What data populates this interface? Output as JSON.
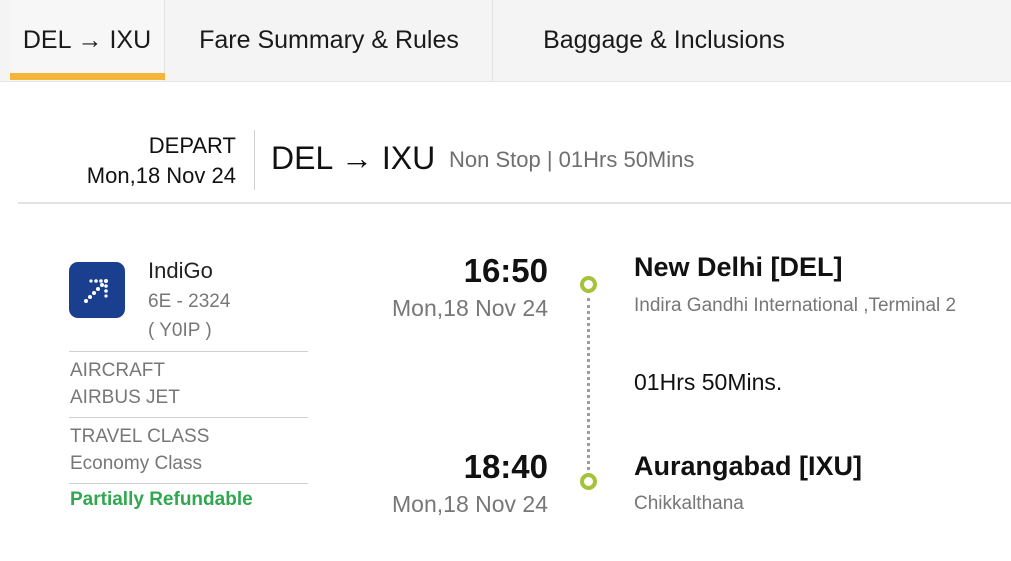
{
  "tabs": [
    {
      "label": "DEL → IXU",
      "active": true
    },
    {
      "label": "Fare Summary & Rules",
      "active": false
    },
    {
      "label": "Baggage & Inclusions",
      "active": false
    }
  ],
  "colors": {
    "active_tab_underline": "#f4b53a",
    "timeline_node": "#a4c23a",
    "refundable_text": "#2fa84f",
    "airline_logo_bg": "#1a3f8f"
  },
  "segment_header": {
    "depart_label": "DEPART",
    "depart_date": "Mon,18 Nov 24",
    "route": "DEL → IXU",
    "meta": "Non Stop | 01Hrs 50Mins"
  },
  "airline": {
    "logo_icon": "indigo-logo-icon",
    "name": "IndiGo",
    "flight_no": "6E - 2324",
    "fare_code": "( Y0IP )",
    "aircraft_label": "AIRCRAFT",
    "aircraft_value": "AIRBUS JET",
    "class_label": "TRAVEL CLASS",
    "class_value": "Economy Class",
    "refund_status": "Partially Refundable"
  },
  "departure": {
    "time": "16:50",
    "date": "Mon,18 Nov 24",
    "city": "New Delhi [DEL]",
    "airport": "Indira Gandhi International ,Terminal 2"
  },
  "duration": "01Hrs 50Mins.",
  "arrival": {
    "time": "18:40",
    "date": "Mon,18 Nov 24",
    "city": "Aurangabad [IXU]",
    "airport": "Chikkalthana"
  }
}
